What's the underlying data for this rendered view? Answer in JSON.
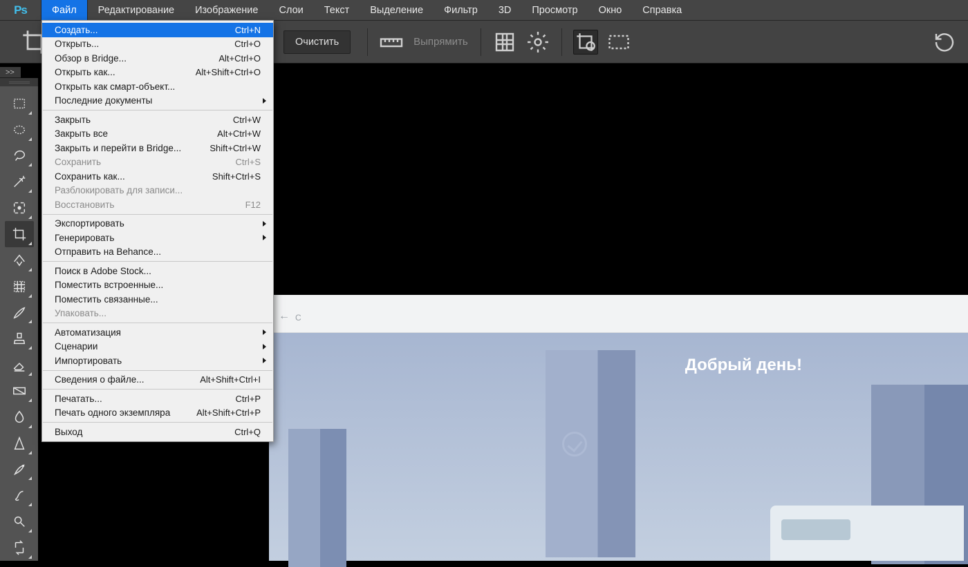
{
  "app": {
    "logo_text": "Ps"
  },
  "menubar": {
    "items": [
      "Файл",
      "Редактирование",
      "Изображение",
      "Слои",
      "Текст",
      "Выделение",
      "Фильтр",
      "3D",
      "Просмотр",
      "Окно",
      "Справка"
    ],
    "active_index": 0
  },
  "optionsbar": {
    "clear_label": "Очистить",
    "straighten_label": "Выпрямить"
  },
  "expand_label": ">>",
  "dropdown": {
    "groups": [
      [
        {
          "label": "Создать...",
          "shortcut": "Ctrl+N",
          "highlight": true
        },
        {
          "label": "Открыть...",
          "shortcut": "Ctrl+O"
        },
        {
          "label": "Обзор в Bridge...",
          "shortcut": "Alt+Ctrl+O"
        },
        {
          "label": "Открыть как...",
          "shortcut": "Alt+Shift+Ctrl+O"
        },
        {
          "label": "Открыть как смарт-объект..."
        },
        {
          "label": "Последние документы",
          "submenu": true
        }
      ],
      [
        {
          "label": "Закрыть",
          "shortcut": "Ctrl+W"
        },
        {
          "label": "Закрыть все",
          "shortcut": "Alt+Ctrl+W"
        },
        {
          "label": "Закрыть и перейти в Bridge...",
          "shortcut": "Shift+Ctrl+W"
        },
        {
          "label": "Сохранить",
          "shortcut": "Ctrl+S",
          "disabled": true
        },
        {
          "label": "Сохранить как...",
          "shortcut": "Shift+Ctrl+S"
        },
        {
          "label": "Разблокировать для записи...",
          "disabled": true
        },
        {
          "label": "Восстановить",
          "shortcut": "F12",
          "disabled": true
        }
      ],
      [
        {
          "label": "Экспортировать",
          "submenu": true
        },
        {
          "label": "Генерировать",
          "submenu": true
        },
        {
          "label": "Отправить на Behance..."
        }
      ],
      [
        {
          "label": "Поиск в Adobe Stock..."
        },
        {
          "label": "Поместить встроенные..."
        },
        {
          "label": "Поместить связанные..."
        },
        {
          "label": "Упаковать...",
          "disabled": true
        }
      ],
      [
        {
          "label": "Автоматизация",
          "submenu": true
        },
        {
          "label": "Сценарии",
          "submenu": true
        },
        {
          "label": "Импортировать",
          "submenu": true
        }
      ],
      [
        {
          "label": "Сведения о файле...",
          "shortcut": "Alt+Shift+Ctrl+I"
        }
      ],
      [
        {
          "label": "Печатать...",
          "shortcut": "Ctrl+P"
        },
        {
          "label": "Печать одного экземпляра",
          "shortcut": "Alt+Shift+Ctrl+P"
        }
      ],
      [
        {
          "label": "Выход",
          "shortcut": "Ctrl+Q"
        }
      ]
    ]
  },
  "tools": [
    {
      "name": "marquee-rect"
    },
    {
      "name": "marquee-ellipse"
    },
    {
      "name": "lasso"
    },
    {
      "name": "magic-wand"
    },
    {
      "name": "quick-select"
    },
    {
      "name": "crop",
      "selected": true
    },
    {
      "name": "slice"
    },
    {
      "name": "frame"
    },
    {
      "name": "brush"
    },
    {
      "name": "stamp"
    },
    {
      "name": "eraser"
    },
    {
      "name": "gradient"
    },
    {
      "name": "blur"
    },
    {
      "name": "sharpen"
    },
    {
      "name": "pen"
    },
    {
      "name": "smudge"
    },
    {
      "name": "dodge"
    },
    {
      "name": "swap"
    }
  ],
  "canvas": {
    "greeting_text": "Добрый день!",
    "addr_placeholder": "C"
  }
}
